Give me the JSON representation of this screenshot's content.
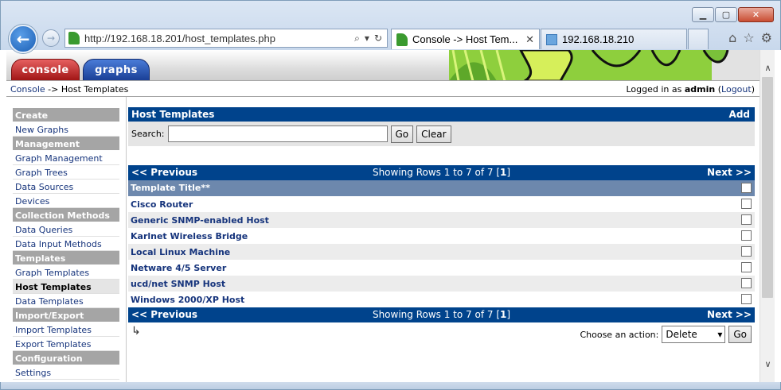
{
  "browser": {
    "url": "http://192.168.18.201/host_templates.php",
    "tabs": [
      {
        "label": "Console -> Host Tem..."
      },
      {
        "label": "192.168.18.210"
      }
    ]
  },
  "header": {
    "tabs": [
      "console",
      "graphs"
    ]
  },
  "breadcrumb": {
    "link": "Console",
    "separator": " -> ",
    "current": "Host Templates"
  },
  "login": {
    "prefix": "Logged in as ",
    "user": "admin",
    "logout": "Logout"
  },
  "sidebar": {
    "sections": [
      {
        "head": "Create",
        "items": [
          {
            "label": "New Graphs"
          }
        ]
      },
      {
        "head": "Management",
        "items": [
          {
            "label": "Graph Management"
          },
          {
            "label": "Graph Trees"
          },
          {
            "label": "Data Sources"
          },
          {
            "label": "Devices"
          }
        ]
      },
      {
        "head": "Collection Methods",
        "items": [
          {
            "label": "Data Queries"
          },
          {
            "label": "Data Input Methods"
          }
        ]
      },
      {
        "head": "Templates",
        "items": [
          {
            "label": "Graph Templates"
          },
          {
            "label": "Host Templates",
            "selected": true
          },
          {
            "label": "Data Templates"
          }
        ]
      },
      {
        "head": "Import/Export",
        "items": [
          {
            "label": "Import Templates"
          },
          {
            "label": "Export Templates"
          }
        ]
      },
      {
        "head": "Configuration",
        "items": [
          {
            "label": "Settings"
          }
        ]
      }
    ]
  },
  "panel": {
    "title": "Host Templates",
    "add_label": "Add",
    "search_label": "Search:",
    "search_value": "",
    "go_label": "Go",
    "clear_label": "Clear"
  },
  "pager": {
    "prev": "<< Previous",
    "next": "Next >>",
    "rows_text": "Showing Rows 1 to 7 of 7 [",
    "page": "1",
    "rows_end": "]"
  },
  "table": {
    "column": "Template Title**",
    "rows": [
      "Cisco Router",
      "Generic SNMP-enabled Host",
      "Karlnet Wireless Bridge",
      "Local Linux Machine",
      "Netware 4/5 Server",
      "ucd/net SNMP Host",
      "Windows 2000/XP Host"
    ]
  },
  "actions": {
    "label": "Choose an action:",
    "selected": "Delete",
    "go_label": "Go"
  }
}
